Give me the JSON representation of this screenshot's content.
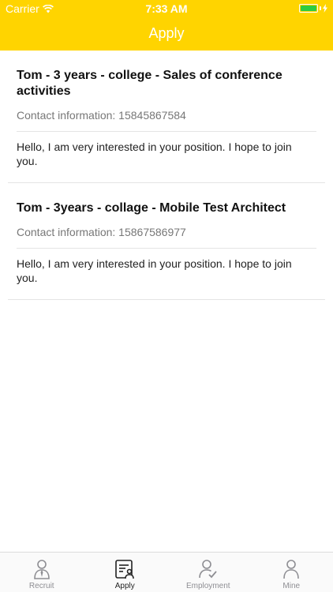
{
  "status_bar": {
    "carrier": "Carrier",
    "time": "7:33 AM"
  },
  "nav": {
    "title": "Apply"
  },
  "applications": [
    {
      "title": "Tom - 3 years - college - Sales of conference activities",
      "contact_label": "Contact information: ",
      "contact_value": "15845867584",
      "message": "Hello, I am very interested in your position. I hope to join you."
    },
    {
      "title": "Tom - 3years - collage - Mobile Test Architect",
      "contact_label": "Contact information: ",
      "contact_value": "15867586977",
      "message": "Hello, I am very interested in your position. I hope to join you."
    }
  ],
  "tabbar": {
    "tabs": [
      {
        "label": "Recruit",
        "icon": "recruit-icon",
        "active": false
      },
      {
        "label": "Apply",
        "icon": "apply-icon",
        "active": true
      },
      {
        "label": "Employment",
        "icon": "employment-icon",
        "active": false
      },
      {
        "label": "Mine",
        "icon": "user-icon",
        "active": false
      }
    ]
  },
  "colors": {
    "header": "#FFD400",
    "battery": "#2ecc40"
  }
}
